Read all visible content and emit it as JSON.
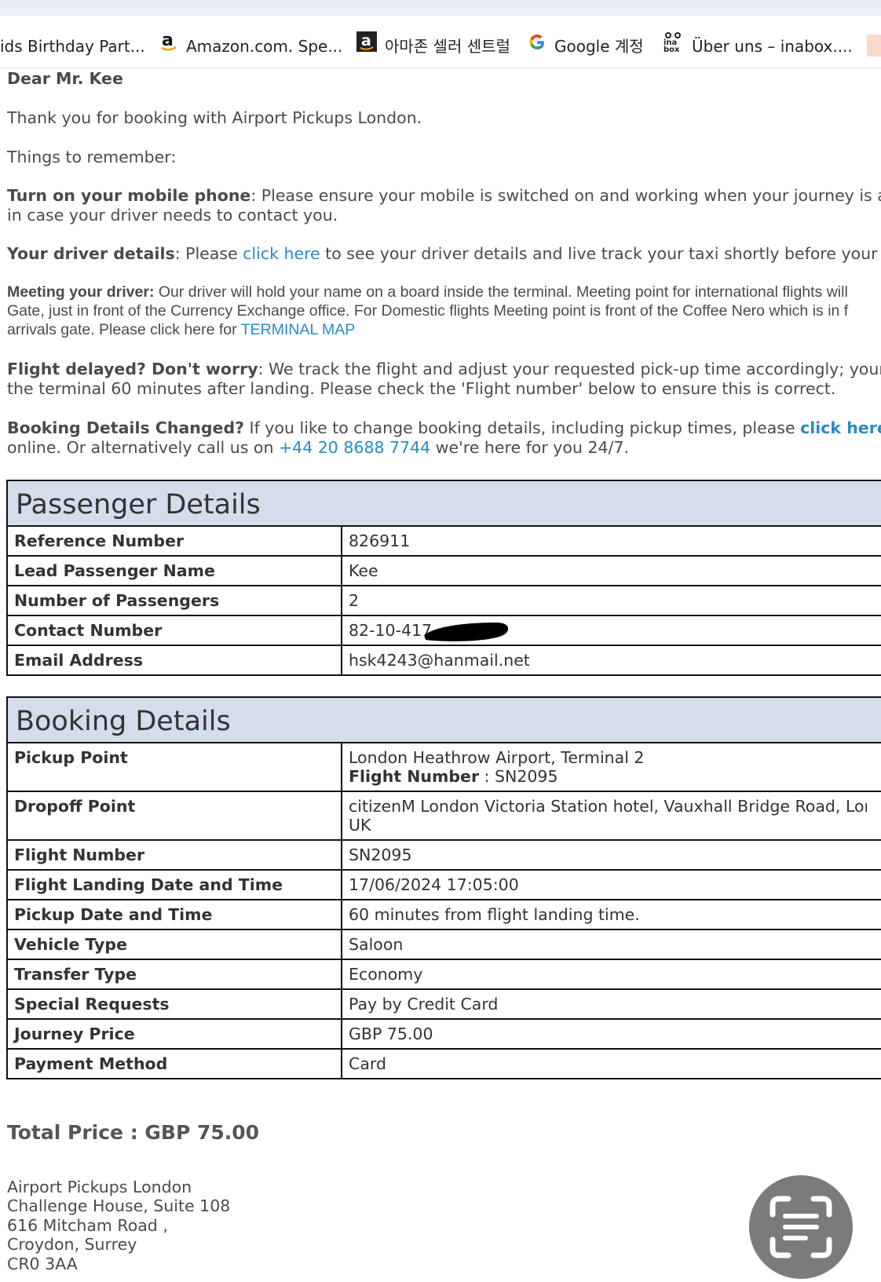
{
  "bookmarks": [
    {
      "label": "ids Birthday Part...",
      "icon": "none"
    },
    {
      "label": "Amazon.com. Spe...",
      "icon": "amazon-icon"
    },
    {
      "label": "아마존 셀러 센트럴",
      "icon": "amazon-box-icon"
    },
    {
      "label": "Google 계정",
      "icon": "google-icon"
    },
    {
      "label": "Über uns – inabox....",
      "icon": "inabox-icon"
    }
  ],
  "email": {
    "greeting": "Dear Mr. Kee",
    "thanks": "Thank you for booking with Airport Pickups London.",
    "remember": "Things to remember:",
    "phone_title": "Turn on your mobile phone",
    "phone_text": ": Please ensure your mobile is switched on and working when your journey is a",
    "phone_text2": "in case your driver needs to contact you.",
    "driver_title": "Your driver details",
    "driver_pre": ": Please ",
    "driver_link": "click here",
    "driver_post": " to see your driver details and live track your taxi shortly before your j",
    "meet_title": "Meeting your driver:",
    "meet_text1": " Our driver will hold your name on a board inside the terminal. Meeting point for international flights will",
    "meet_text2": "Gate, just in front of the Currency Exchange office. For Domestic flights Meeting point is front of the Coffee Nero which is in f",
    "meet_text3": "arrivals gate. Please click here for ",
    "meet_link": "TERMINAL MAP",
    "delay_title": "Flight delayed? Don't worry",
    "delay_text1": ": We track the flight and adjust your requested pick-up time accordingly; your",
    "delay_text2": "the terminal 60 minutes after landing. Please check the 'Flight number' below to ensure this is correct.",
    "change_title": "Booking Details Changed?",
    "change_text1": " If you like to change booking details, including pickup times, please ",
    "change_link": "click here",
    "change_text2a": "online. Or alternatively call us on ",
    "change_phone": "+44 20 8688 7744",
    "change_text2b": " we're here for you 24/7."
  },
  "passenger": {
    "title": "Passenger Details",
    "rows": [
      {
        "k": "Reference Number",
        "v": "826911"
      },
      {
        "k": "Lead Passenger Name",
        "v": "Kee"
      },
      {
        "k": "Number of Passengers",
        "v": "2"
      },
      {
        "k": "Contact Number",
        "v": "82-10-417"
      },
      {
        "k": "Email Address",
        "v": "hsk4243@hanmail.net"
      }
    ]
  },
  "booking": {
    "title": "Booking Details",
    "pickup_k": "Pickup Point",
    "pickup_v1": "London Heathrow Airport, Terminal 2",
    "pickup_flight_label": "Flight Number",
    "pickup_flight_value": " : SN2095",
    "dropoff_k": "Dropoff Point",
    "dropoff_v1": "citizenM London Victoria Station hotel, Vauxhall Bridge Road, Lor",
    "dropoff_v2": "UK",
    "rows": [
      {
        "k": "Flight Number",
        "v": "SN2095"
      },
      {
        "k": "Flight Landing Date and Time",
        "v": "17/06/2024 17:05:00"
      },
      {
        "k": "Pickup Date and Time",
        "v": "60 minutes from flight landing time."
      },
      {
        "k": "Vehicle Type",
        "v": "Saloon"
      },
      {
        "k": "Transfer Type",
        "v": "Economy"
      },
      {
        "k": "Special Requests",
        "v": "Pay by Credit Card"
      },
      {
        "k": "Journey Price",
        "v": "GBP 75.00"
      },
      {
        "k": "Payment Method",
        "v": "Card"
      }
    ]
  },
  "total": "Total Price : GBP 75.00",
  "address": [
    "Airport Pickups London",
    "Challenge House, Suite 108",
    "616 Mitcham Road ,",
    "Croydon, Surrey",
    "CR0 3AA"
  ]
}
